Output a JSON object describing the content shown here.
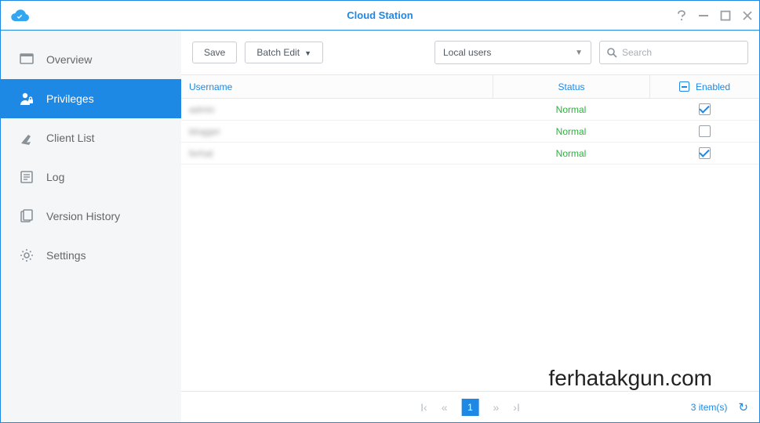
{
  "window": {
    "title": "Cloud Station"
  },
  "sidebar": {
    "items": [
      {
        "label": "Overview"
      },
      {
        "label": "Privileges"
      },
      {
        "label": "Client List"
      },
      {
        "label": "Log"
      },
      {
        "label": "Version History"
      },
      {
        "label": "Settings"
      }
    ]
  },
  "toolbar": {
    "save_label": "Save",
    "batch_edit_label": "Batch Edit",
    "user_filter_selected": "Local users",
    "search_placeholder": "Search"
  },
  "table": {
    "headers": {
      "username": "Username",
      "status": "Status",
      "enabled": "Enabled"
    },
    "rows": [
      {
        "username": "admin",
        "status": "Normal",
        "enabled": true
      },
      {
        "username": "blogger",
        "status": "Normal",
        "enabled": false
      },
      {
        "username": "ferhat",
        "status": "Normal",
        "enabled": true
      }
    ]
  },
  "pager": {
    "page": "1",
    "count_label": "3 item(s)"
  },
  "watermark": "ferhatakgun.com"
}
